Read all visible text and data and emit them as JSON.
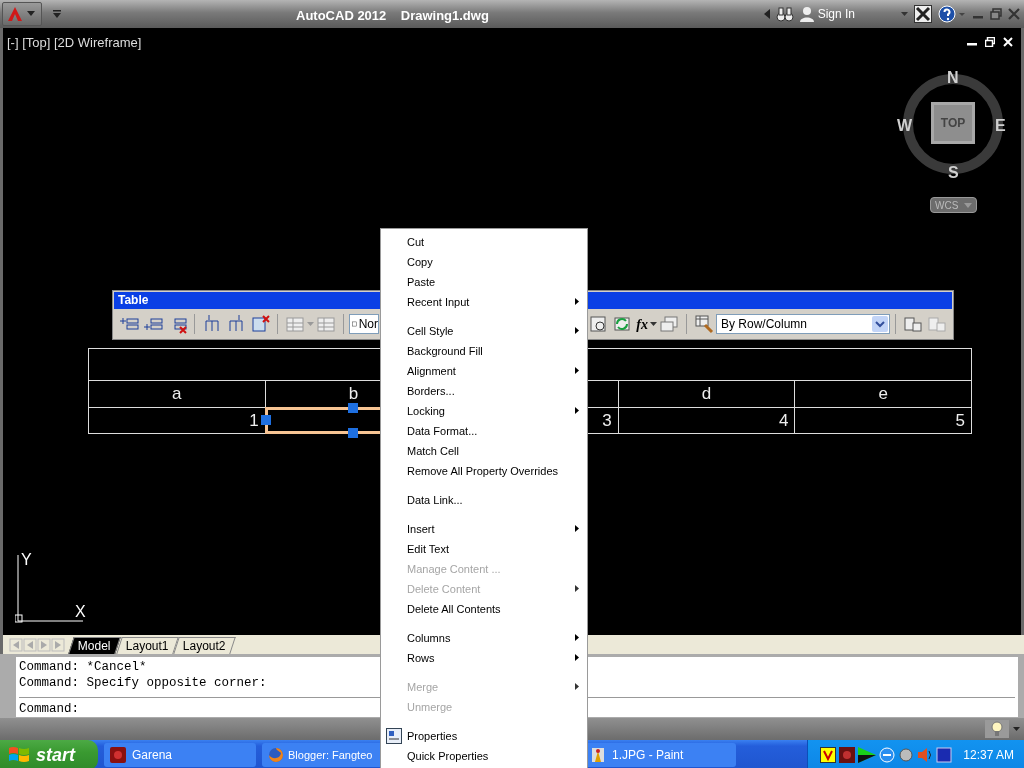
{
  "title_bar": {
    "app_name": "AutoCAD 2012",
    "document": "Drawing1.dwg",
    "sign_in": "Sign In"
  },
  "viewport": {
    "label": "[-] [Top] [2D Wireframe]"
  },
  "viewcube": {
    "north": "N",
    "east": "E",
    "south": "S",
    "west": "W",
    "face": "TOP",
    "coordinate_system": "WCS"
  },
  "ucs_icon": {
    "y_axis": "Y",
    "x_axis": "X"
  },
  "table_toolbar": {
    "title": "Table",
    "cell_style": "Nor",
    "function_button": "fx",
    "match_mode": "By Row/Column"
  },
  "drawing_table": {
    "columns": [
      {
        "label": "a",
        "value": "1",
        "selected": false
      },
      {
        "label": "b",
        "selected": true
      },
      {
        "value": "3",
        "selected": false
      },
      {
        "label": "d",
        "value": "4",
        "selected": false
      },
      {
        "label": "e",
        "value": "5",
        "selected": false
      }
    ]
  },
  "context_menu": {
    "items": [
      {
        "kind": "item",
        "label": "Cut",
        "disabled": false,
        "submenu": false
      },
      {
        "kind": "item",
        "label": "Copy",
        "disabled": false,
        "submenu": false
      },
      {
        "kind": "item",
        "label": "Paste",
        "disabled": false,
        "submenu": false
      },
      {
        "kind": "item",
        "label": "Recent Input",
        "disabled": false,
        "submenu": true
      },
      {
        "kind": "separator"
      },
      {
        "kind": "item",
        "label": "Cell Style",
        "disabled": false,
        "submenu": true
      },
      {
        "kind": "item",
        "label": "Background Fill",
        "disabled": false,
        "submenu": false
      },
      {
        "kind": "item",
        "label": "Alignment",
        "disabled": false,
        "submenu": true
      },
      {
        "kind": "item",
        "label": "Borders...",
        "disabled": false,
        "submenu": false
      },
      {
        "kind": "item",
        "label": "Locking",
        "disabled": false,
        "submenu": true
      },
      {
        "kind": "item",
        "label": "Data Format...",
        "disabled": false,
        "submenu": false
      },
      {
        "kind": "item",
        "label": "Match Cell",
        "disabled": false,
        "submenu": false
      },
      {
        "kind": "item",
        "label": "Remove All Property Overrides",
        "disabled": false,
        "submenu": false
      },
      {
        "kind": "separator"
      },
      {
        "kind": "item",
        "label": "Data Link...",
        "disabled": false,
        "submenu": false
      },
      {
        "kind": "separator"
      },
      {
        "kind": "item",
        "label": "Insert",
        "disabled": false,
        "submenu": true
      },
      {
        "kind": "item",
        "label": "Edit Text",
        "disabled": false,
        "submenu": false
      },
      {
        "kind": "item",
        "label": "Manage Content ...",
        "disabled": true,
        "submenu": false
      },
      {
        "kind": "item",
        "label": "Delete Content",
        "disabled": true,
        "submenu": true
      },
      {
        "kind": "item",
        "label": "Delete All Contents",
        "disabled": false,
        "submenu": false
      },
      {
        "kind": "separator"
      },
      {
        "kind": "item",
        "label": "Columns",
        "disabled": false,
        "submenu": true
      },
      {
        "kind": "item",
        "label": "Rows",
        "disabled": false,
        "submenu": true
      },
      {
        "kind": "separator"
      },
      {
        "kind": "item",
        "label": "Merge",
        "disabled": true,
        "submenu": true
      },
      {
        "kind": "item",
        "label": "Unmerge",
        "disabled": true,
        "submenu": false
      },
      {
        "kind": "separator"
      },
      {
        "kind": "icon_item",
        "label": "Properties",
        "disabled": false,
        "submenu": false
      },
      {
        "kind": "item",
        "label": "Quick Properties",
        "disabled": false,
        "submenu": false
      }
    ]
  },
  "layout_tabs": [
    {
      "label": "Model",
      "selected": true
    },
    {
      "label": "Layout1",
      "selected": false
    },
    {
      "label": "Layout2",
      "selected": false
    }
  ],
  "command_line": {
    "history": [
      "Command: *Cancel*",
      "Command: Specify opposite corner:"
    ],
    "prompt": "Command:"
  },
  "taskbar": {
    "start": "start",
    "tasks": [
      {
        "kind": "game",
        "label": "Garena"
      },
      {
        "kind": "browser",
        "label": "Blogger: Fangteo"
      },
      {
        "kind": "paint",
        "label": "1.JPG - Paint"
      }
    ],
    "clock": "12:37 AM"
  }
}
